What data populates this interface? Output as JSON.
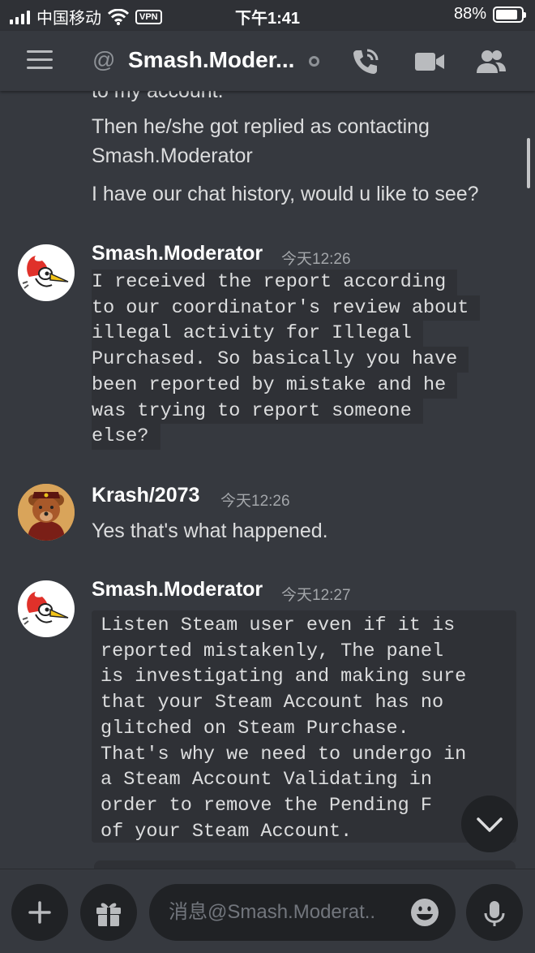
{
  "status_bar": {
    "carrier": "中国移动",
    "vpn": "VPN",
    "time": "下午1:41",
    "battery": "88%",
    "battery_level": 0.88
  },
  "header": {
    "title": "Smash.Moder..."
  },
  "messages": {
    "continued": {
      "line1": "to my account.",
      "line2": "Then he/she got replied as contacting",
      "line3": "Smash.Moderator",
      "line4": "I have our chat history, would u like to see?"
    },
    "m1": {
      "author": "Smash.Moderator",
      "timestamp": "今天12:26",
      "lines": [
        "I received the report according",
        "to our coordinator's review about",
        "illegal activity for Illegal",
        "Purchased. So basically you have",
        "been reported by mistake and he",
        "was trying to report someone",
        "else?"
      ]
    },
    "m2": {
      "author": "Krash/2073",
      "timestamp": "今天12:26",
      "text": "Yes that's what happened."
    },
    "m3": {
      "author": "Smash.Moderator",
      "timestamp": "今天12:27",
      "lines": [
        "Listen Steam user even if it is",
        "reported mistakenly, The panel",
        "is investigating and making sure",
        "that your Steam Account has no",
        "glitched on Steam Purchase.",
        "That's why we need to undergo in",
        "a Steam Account Validating in",
        "order to remove the Pending F",
        "of your Steam Account."
      ]
    }
  },
  "composer": {
    "placeholder": "消息@Smash.Moderat.."
  },
  "colors": {
    "background": "#36393f",
    "codeblock": "#2f3136",
    "button": "#202225",
    "muted": "#a3a6aa"
  },
  "icons": [
    "menu-icon",
    "at-icon",
    "phone-call-icon",
    "video-icon",
    "members-icon",
    "chevron-down-icon",
    "plus-icon",
    "gift-icon",
    "emoji-icon",
    "microphone-icon"
  ]
}
